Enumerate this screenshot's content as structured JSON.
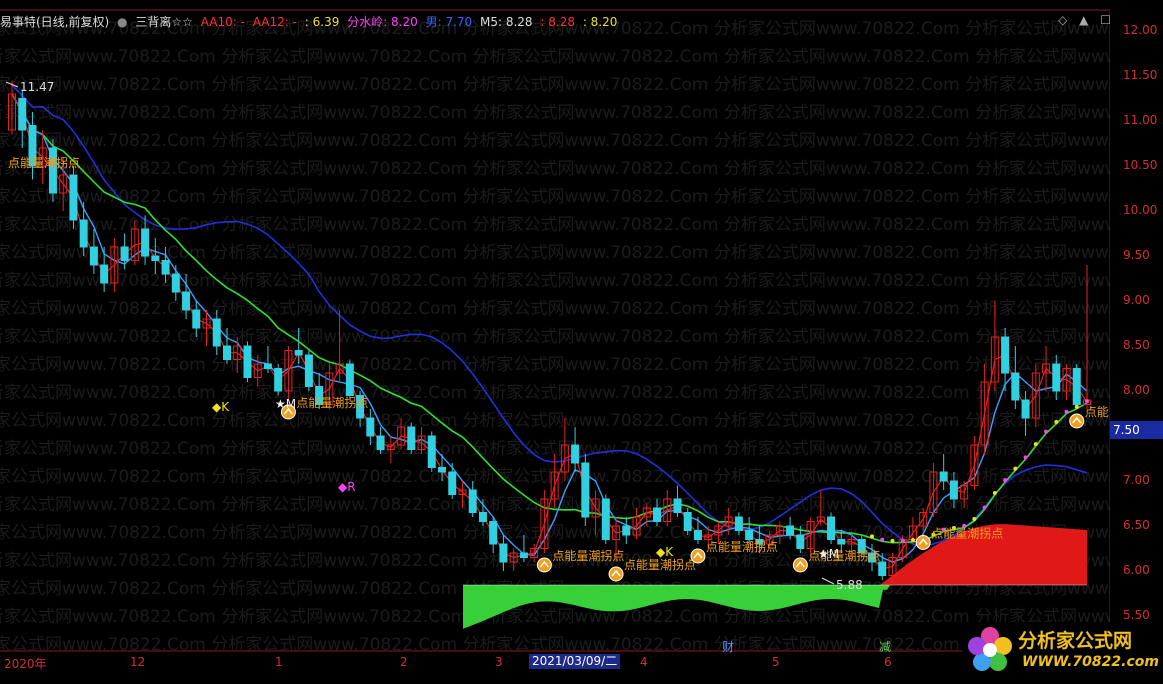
{
  "header": {
    "title": "易事特(日线,前复权)",
    "indicator": "三背离☆☆",
    "aa10": "AA10: -",
    "aa12": "AA12: -",
    "val1": ": 6.39",
    "fenshuiling": "分水岭: 8.20",
    "nan": "男: 7.70",
    "m5": "M5: 8.28",
    "val2": ": 8.28",
    "val3": ": 8.20",
    "colors": {
      "white": "#dddddd",
      "red": "#ff3030",
      "yellow": "#f0e020",
      "magenta": "#ff40ff",
      "blue": "#4060ff"
    }
  },
  "window_buttons": [
    "◇",
    "▲",
    "☐"
  ],
  "watermark": "分析家公式网www.70822.Com",
  "y_axis": {
    "ticks": [
      "12.00",
      "11.50",
      "11.00",
      "10.50",
      "10.00",
      "9.50",
      "9.00",
      "8.50",
      "8.00",
      "7.50",
      "7.00",
      "6.50",
      "6.00",
      "5.50"
    ],
    "current_price": "7.50",
    "color": "#d32f2f"
  },
  "x_axis": {
    "ticks": [
      "2020年",
      "12",
      "1",
      "2",
      "3",
      "4",
      "5",
      "6"
    ],
    "selected_date": "2021/03/09/二",
    "events": [
      {
        "label": "财",
        "color": "#6090ff"
      },
      {
        "label": "减",
        "color": "#60d060"
      }
    ]
  },
  "annotations": {
    "high_label": "11.47",
    "low_label": "5.88",
    "signal_texts": [
      "点能量潮拐点",
      "点能量潮拐点",
      "点能量潮拐点",
      "点能量潮拐点",
      "点能量潮拐点",
      "点能量潮拐点",
      "点能"
    ],
    "k_marks": [
      "K",
      "K"
    ],
    "m_marks": [
      "M",
      "M"
    ],
    "r_mark": "R"
  },
  "chart_data": {
    "type": "candlestick",
    "ylim": [
      5.5,
      12.1
    ],
    "candles": [
      [
        10.9,
        11.45,
        10.85,
        11.3
      ],
      [
        11.25,
        11.35,
        10.7,
        10.9
      ],
      [
        10.95,
        11.1,
        10.35,
        10.5
      ],
      [
        10.5,
        10.9,
        10.3,
        10.7
      ],
      [
        10.7,
        10.8,
        10.1,
        10.2
      ],
      [
        10.2,
        10.6,
        10.0,
        10.4
      ],
      [
        10.4,
        10.5,
        9.8,
        9.9
      ],
      [
        9.9,
        10.1,
        9.5,
        9.6
      ],
      [
        9.6,
        9.8,
        9.3,
        9.4
      ],
      [
        9.4,
        9.6,
        9.1,
        9.2
      ],
      [
        9.2,
        9.7,
        9.1,
        9.6
      ],
      [
        9.6,
        9.75,
        9.35,
        9.45
      ],
      [
        9.45,
        9.9,
        9.4,
        9.8
      ],
      [
        9.8,
        9.95,
        9.4,
        9.5
      ],
      [
        9.5,
        9.7,
        9.3,
        9.45
      ],
      [
        9.45,
        9.6,
        9.2,
        9.3
      ],
      [
        9.3,
        9.4,
        9.0,
        9.1
      ],
      [
        9.1,
        9.3,
        8.8,
        8.9
      ],
      [
        8.9,
        9.0,
        8.6,
        8.7
      ],
      [
        8.7,
        8.9,
        8.5,
        8.8
      ],
      [
        8.8,
        8.9,
        8.4,
        8.5
      ],
      [
        8.5,
        8.7,
        8.3,
        8.35
      ],
      [
        8.35,
        8.6,
        8.2,
        8.5
      ],
      [
        8.5,
        8.55,
        8.1,
        8.15
      ],
      [
        8.15,
        8.4,
        8.05,
        8.3
      ],
      [
        8.3,
        8.5,
        8.2,
        8.25
      ],
      [
        8.25,
        8.3,
        7.95,
        8.0
      ],
      [
        8.0,
        8.5,
        7.9,
        8.45
      ],
      [
        8.45,
        8.7,
        8.3,
        8.4
      ],
      [
        8.4,
        8.45,
        8.0,
        8.05
      ],
      [
        8.05,
        8.2,
        7.8,
        7.85
      ],
      [
        7.85,
        8.3,
        7.8,
        8.2
      ],
      [
        8.2,
        8.9,
        8.1,
        8.3
      ],
      [
        8.3,
        8.35,
        7.9,
        7.95
      ],
      [
        7.95,
        8.0,
        7.6,
        7.7
      ],
      [
        7.7,
        7.8,
        7.4,
        7.5
      ],
      [
        7.5,
        7.6,
        7.3,
        7.35
      ],
      [
        7.35,
        7.5,
        7.2,
        7.4
      ],
      [
        7.4,
        7.7,
        7.35,
        7.6
      ],
      [
        7.6,
        7.65,
        7.3,
        7.35
      ],
      [
        7.35,
        7.6,
        7.3,
        7.5
      ],
      [
        7.5,
        7.55,
        7.1,
        7.15
      ],
      [
        7.15,
        7.3,
        7.0,
        7.1
      ],
      [
        7.1,
        7.2,
        6.8,
        6.85
      ],
      [
        6.85,
        7.0,
        6.7,
        6.9
      ],
      [
        6.9,
        7.0,
        6.6,
        6.65
      ],
      [
        6.65,
        6.8,
        6.5,
        6.55
      ],
      [
        6.55,
        6.6,
        6.2,
        6.3
      ],
      [
        6.3,
        6.4,
        6.0,
        6.1
      ],
      [
        6.1,
        6.25,
        6.0,
        6.2
      ],
      [
        6.2,
        6.4,
        6.1,
        6.15
      ],
      [
        6.15,
        6.3,
        6.1,
        6.25
      ],
      [
        6.25,
        6.9,
        6.2,
        6.8
      ],
      [
        6.8,
        7.3,
        6.7,
        7.1
      ],
      [
        7.1,
        7.7,
        7.0,
        7.4
      ],
      [
        7.4,
        7.6,
        7.1,
        7.2
      ],
      [
        7.2,
        7.3,
        6.5,
        6.6
      ],
      [
        6.6,
        6.9,
        6.4,
        6.8
      ],
      [
        6.8,
        6.85,
        6.3,
        6.35
      ],
      [
        6.35,
        6.6,
        6.1,
        6.5
      ],
      [
        6.5,
        6.6,
        6.3,
        6.4
      ],
      [
        6.4,
        6.7,
        6.35,
        6.6
      ],
      [
        6.6,
        6.75,
        6.5,
        6.7
      ],
      [
        6.7,
        6.8,
        6.5,
        6.55
      ],
      [
        6.55,
        6.9,
        6.5,
        6.8
      ],
      [
        6.8,
        6.95,
        6.6,
        6.65
      ],
      [
        6.65,
        6.7,
        6.4,
        6.45
      ],
      [
        6.45,
        6.6,
        6.3,
        6.35
      ],
      [
        6.35,
        6.5,
        6.25,
        6.4
      ],
      [
        6.4,
        6.55,
        6.3,
        6.5
      ],
      [
        6.5,
        6.7,
        6.4,
        6.6
      ],
      [
        6.6,
        6.65,
        6.4,
        6.45
      ],
      [
        6.45,
        6.6,
        6.3,
        6.35
      ],
      [
        6.35,
        6.5,
        6.2,
        6.3
      ],
      [
        6.3,
        6.45,
        6.25,
        6.4
      ],
      [
        6.4,
        6.55,
        6.3,
        6.5
      ],
      [
        6.5,
        6.6,
        6.35,
        6.4
      ],
      [
        6.4,
        6.5,
        6.2,
        6.25
      ],
      [
        6.25,
        6.6,
        6.2,
        6.55
      ],
      [
        6.55,
        6.9,
        6.5,
        6.6
      ],
      [
        6.6,
        6.65,
        6.3,
        6.35
      ],
      [
        6.35,
        6.45,
        6.2,
        6.3
      ],
      [
        6.3,
        6.4,
        6.2,
        6.35
      ],
      [
        6.35,
        6.4,
        6.15,
        6.2
      ],
      [
        6.2,
        6.3,
        6.0,
        6.1
      ],
      [
        6.1,
        6.2,
        5.9,
        5.95
      ],
      [
        5.95,
        6.2,
        5.88,
        6.15
      ],
      [
        6.15,
        6.4,
        6.1,
        6.35
      ],
      [
        6.35,
        6.6,
        6.3,
        6.5
      ],
      [
        6.5,
        6.7,
        6.45,
        6.65
      ],
      [
        6.65,
        7.2,
        6.6,
        7.1
      ],
      [
        7.1,
        7.3,
        6.9,
        7.0
      ],
      [
        7.0,
        7.1,
        6.7,
        6.8
      ],
      [
        6.8,
        7.0,
        6.7,
        6.95
      ],
      [
        6.95,
        7.5,
        6.9,
        7.4
      ],
      [
        7.4,
        8.3,
        7.3,
        8.1
      ],
      [
        8.1,
        9.0,
        8.0,
        8.6
      ],
      [
        8.6,
        8.7,
        8.0,
        8.2
      ],
      [
        8.2,
        8.5,
        7.8,
        7.9
      ],
      [
        7.9,
        8.0,
        7.5,
        7.7
      ],
      [
        7.7,
        8.3,
        7.6,
        8.2
      ],
      [
        8.2,
        8.5,
        8.0,
        8.3
      ],
      [
        8.3,
        8.4,
        7.9,
        8.0
      ],
      [
        8.0,
        8.3,
        7.9,
        8.25
      ],
      [
        8.25,
        8.3,
        7.8,
        7.85
      ],
      [
        7.85,
        9.4,
        7.8,
        7.9
      ]
    ]
  }
}
